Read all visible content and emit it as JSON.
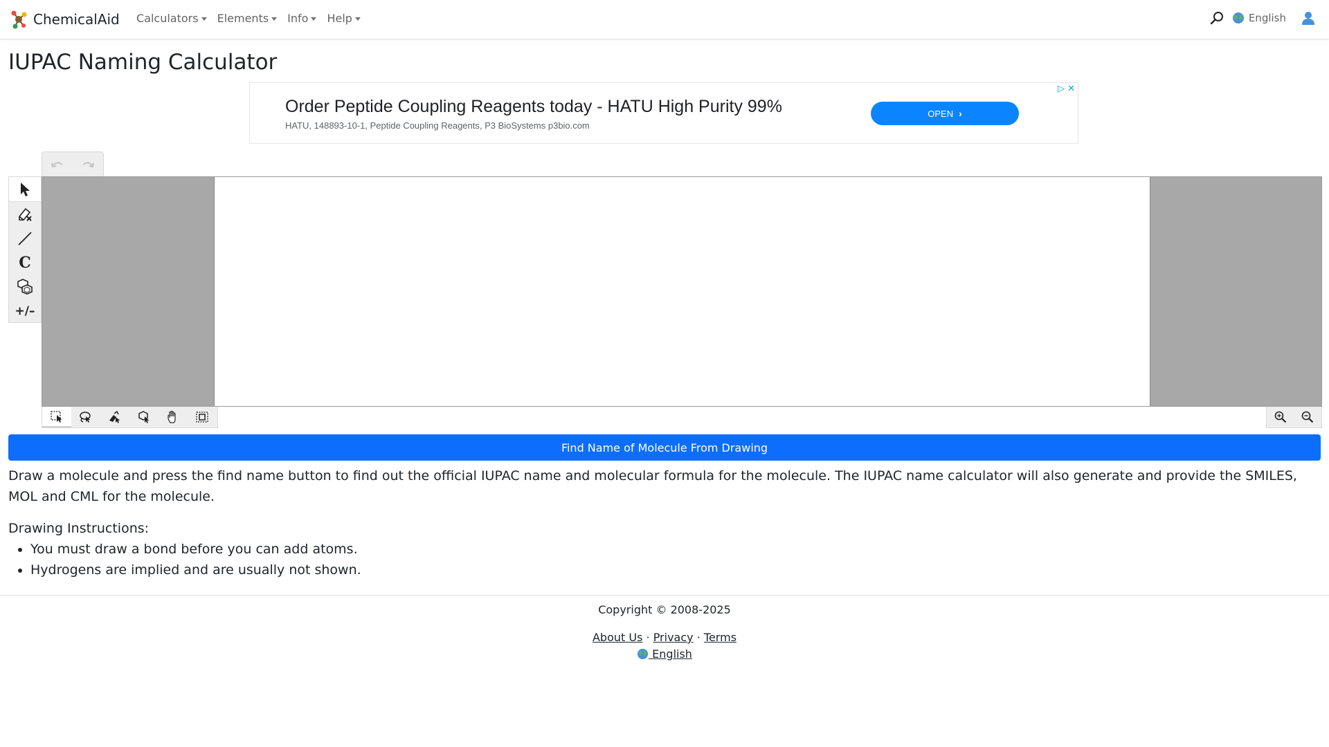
{
  "navbar": {
    "brand": "ChemicalAid",
    "menu": [
      {
        "label": "Calculators"
      },
      {
        "label": "Elements"
      },
      {
        "label": "Info"
      },
      {
        "label": "Help"
      }
    ],
    "language": "English",
    "icons": {
      "search": "search-icon",
      "globe": "globe-icon",
      "user": "user-icon"
    }
  },
  "page": {
    "title": "IUPAC Naming Calculator"
  },
  "ad": {
    "headline": "Order Peptide Coupling Reagents today - HATU High Purity 99%",
    "subline": "HATU, 148893-10-1, Peptide Coupling Reagents, P3 BioSystems p3bio.com",
    "button": "OPEN"
  },
  "editor": {
    "top_tools": [
      "undo-icon",
      "redo-icon"
    ],
    "left_tools": [
      "select-arrow-icon",
      "eraser-icon",
      "bond-line-icon",
      "carbon-atom-icon",
      "ring-template-icon",
      "charge-icon"
    ],
    "left_active": "select-arrow-icon",
    "atom_label": "C",
    "charge_label": "+/–",
    "bottom_tools": [
      "rectangle-select-icon",
      "lasso-select-icon",
      "fragment-select-icon",
      "zoom-select-icon",
      "pan-hand-icon",
      "select-all-icon"
    ],
    "bottom_active": "rectangle-select-icon",
    "zoom_tools": [
      "zoom-in-icon",
      "zoom-out-icon"
    ]
  },
  "main": {
    "find_button": "Find Name of Molecule From Drawing",
    "description": "Draw a molecule and press the find name button to find out the official IUPAC name and molecular formula for the molecule. The IUPAC name calculator will also generate and provide the SMILES, MOL and CML for the molecule.",
    "instructions_heading": "Drawing Instructions:",
    "instructions": [
      "You must draw a bond before you can add atoms.",
      "Hydrogens are implied and are usually not shown."
    ]
  },
  "footer": {
    "copyright": "Copyright © 2008-2025",
    "links": [
      "About Us",
      "Privacy",
      "Terms"
    ],
    "separator": "·",
    "language": "English"
  },
  "colors": {
    "primary": "#0d6efd",
    "ad_button": "#0a84ff",
    "canvas_gutter": "#a8a8a8",
    "toolbar": "#eeeeee"
  }
}
